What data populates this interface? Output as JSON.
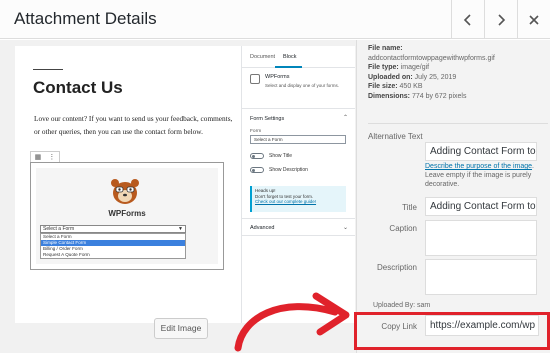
{
  "header": {
    "title": "Attachment Details"
  },
  "preview": {
    "page_title": "Contact Us",
    "paragraph": "Love our content? If you want to send us your feedback, comments, or other queries, then you can use the contact form below.",
    "form_name": "WPForms",
    "select_value": "Select a Form",
    "options": [
      "Select a Form",
      "Simple Contact Form",
      "Billing / Order Form",
      "Request A Quote Form"
    ],
    "sidebar": {
      "tab_document": "Document",
      "tab_block": "Block",
      "block_name": "WPForms",
      "block_desc": "Select and display one of your forms.",
      "form_settings": "Form Settings",
      "form_label": "Form",
      "form_select": "Select a Form",
      "show_title": "Show Title",
      "show_description": "Show Description",
      "notice_line1": "Heads up!",
      "notice_line2": "Don't forget to test your form.",
      "notice_link": "Check out our complete guide!",
      "advanced": "Advanced"
    },
    "edit_image": "Edit Image"
  },
  "details": {
    "file_name_label": "File name:",
    "file_name": "addcontactformtowppagewithwpforms.gif",
    "file_type_label": "File type:",
    "file_type": "image/gif",
    "uploaded_on_label": "Uploaded on:",
    "uploaded_on": "July 25, 2019",
    "file_size_label": "File size:",
    "file_size": "450 KB",
    "dimensions_label": "Dimensions:",
    "dimensions": "774 by 672 pixels",
    "alt_text_label": "Alternative Text",
    "alt_text_value": "Adding Contact Form to",
    "help_link": "Describe the purpose of the image",
    "help_rest": ". Leave empty if the image is purely decorative.",
    "title_label": "Title",
    "title_value": "Adding Contact Form to",
    "caption_label": "Caption",
    "caption_value": "",
    "description_label": "Description",
    "description_value": "",
    "uploaded_by": "Uploaded By: sam",
    "copy_link_label": "Copy Link",
    "copy_link_value": "https://example.com/wp"
  },
  "colors": {
    "highlight": "#e0222b",
    "link": "#0073aa"
  }
}
